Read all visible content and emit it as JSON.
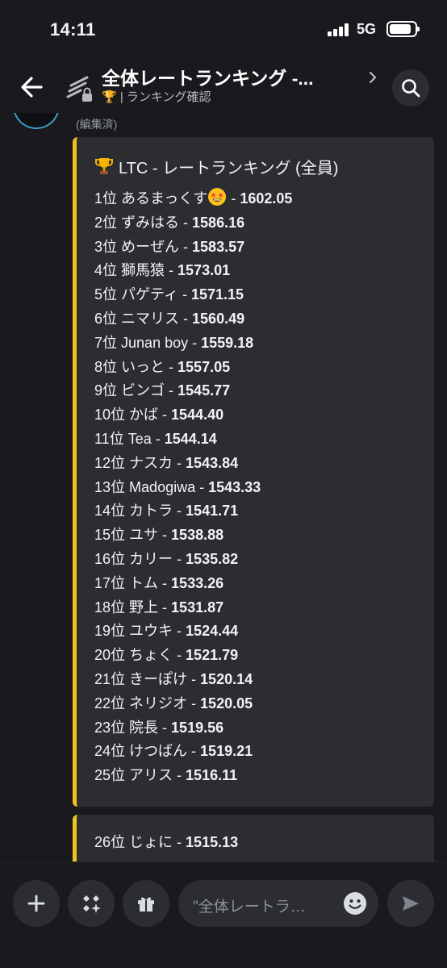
{
  "status_bar": {
    "time": "14:11",
    "network": "5G"
  },
  "header": {
    "title": "全体レートランキング -...",
    "subtitle": "🏆 | ランキング確認"
  },
  "message": {
    "edited_label": "(編集済)",
    "embed_title": "LTC - レートランキング (全員)",
    "rankings": [
      {
        "rank": "1位",
        "name": "あるまっくす",
        "sep": " - ",
        "rate": "1602.05",
        "emoji": "star-struck"
      },
      {
        "rank": "2位",
        "name": "ずみはる",
        "sep": " - ",
        "rate": "1586.16"
      },
      {
        "rank": "3位",
        "name": "めーぜん",
        "sep": " - ",
        "rate": "1583.57"
      },
      {
        "rank": "4位",
        "name": "獅馬猿",
        "sep": " - ",
        "rate": "1573.01"
      },
      {
        "rank": "5位",
        "name": "パゲティ",
        "sep": " - ",
        "rate": "1571.15"
      },
      {
        "rank": "6位",
        "name": "ニマリス",
        "sep": " - ",
        "rate": "1560.49"
      },
      {
        "rank": "7位",
        "name": "Junan boy",
        "sep": " - ",
        "rate": "1559.18"
      },
      {
        "rank": "8位",
        "name": "いっと",
        "sep": " - ",
        "rate": "1557.05"
      },
      {
        "rank": "9位",
        "name": "ビンゴ",
        "sep": " - ",
        "rate": "1545.77"
      },
      {
        "rank": "10位",
        "name": "かば",
        "sep": " - ",
        "rate": "1544.40"
      },
      {
        "rank": "11位",
        "name": "Tea",
        "sep": " - ",
        "rate": "1544.14"
      },
      {
        "rank": "12位",
        "name": "ナスカ",
        "sep": " - ",
        "rate": "1543.84"
      },
      {
        "rank": "13位",
        "name": "Madogiwa",
        "sep": " - ",
        "rate": "1543.33"
      },
      {
        "rank": "14位",
        "name": "カトラ",
        "sep": " - ",
        "rate": "1541.71"
      },
      {
        "rank": "15位",
        "name": "ユサ",
        "sep": " - ",
        "rate": "1538.88"
      },
      {
        "rank": "16位",
        "name": "カリー",
        "sep": " - ",
        "rate": "1535.82"
      },
      {
        "rank": "17位",
        "name": "トム",
        "sep": " - ",
        "rate": "1533.26"
      },
      {
        "rank": "18位",
        "name": "野上",
        "sep": " - ",
        "rate": "1531.87"
      },
      {
        "rank": "19位",
        "name": "ユウキ",
        "sep": " - ",
        "rate": "1524.44"
      },
      {
        "rank": "20位",
        "name": "ちょく",
        "sep": " - ",
        "rate": "1521.79"
      },
      {
        "rank": "21位",
        "name": "きーぽけ",
        "sep": " - ",
        "rate": "1520.14"
      },
      {
        "rank": "22位",
        "name": "ネリジオ",
        "sep": " - ",
        "rate": "1520.05"
      },
      {
        "rank": "23位",
        "name": "院長",
        "sep": " - ",
        "rate": "1519.56"
      },
      {
        "rank": "24位",
        "name": "けつばん",
        "sep": " - ",
        "rate": "1519.21"
      },
      {
        "rank": "25位",
        "name": "アリス",
        "sep": " - ",
        "rate": "1516.11"
      }
    ],
    "rankings_continued": [
      {
        "rank": "26位",
        "name": "じょに",
        "sep": " - ",
        "rate": "1515.13"
      }
    ]
  },
  "composer": {
    "placeholder": "\"全体レートラ…"
  },
  "colors": {
    "accent_bar": "#f0c419",
    "embed_bg": "#2b2d31",
    "background": "#1a1a1e"
  },
  "icons": [
    "back-arrow-icon",
    "text-channel-locked-icon",
    "chevron-right-icon",
    "search-icon",
    "plus-icon",
    "apps-icon",
    "gift-icon",
    "emoji-icon",
    "send-icon",
    "trophy-icon"
  ]
}
